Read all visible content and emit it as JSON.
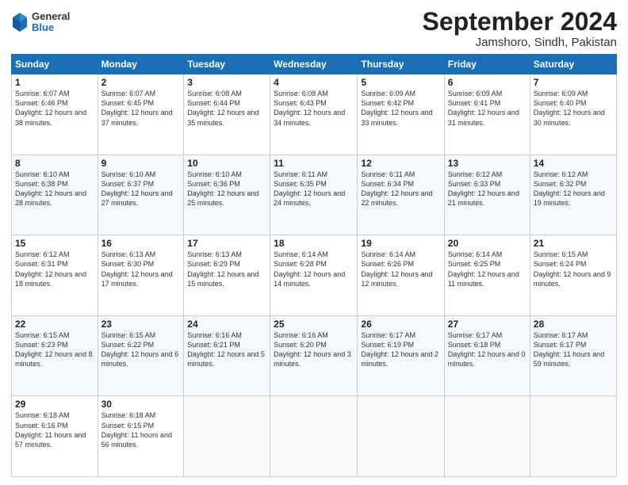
{
  "header": {
    "logo": {
      "line1": "General",
      "line2": "Blue"
    },
    "title": "September 2024",
    "location": "Jamshoro, Sindh, Pakistan"
  },
  "days_of_week": [
    "Sunday",
    "Monday",
    "Tuesday",
    "Wednesday",
    "Thursday",
    "Friday",
    "Saturday"
  ],
  "weeks": [
    [
      {
        "day": "1",
        "sunrise": "6:07 AM",
        "sunset": "6:46 PM",
        "daylight": "12 hours and 38 minutes."
      },
      {
        "day": "2",
        "sunrise": "6:07 AM",
        "sunset": "6:45 PM",
        "daylight": "12 hours and 37 minutes."
      },
      {
        "day": "3",
        "sunrise": "6:08 AM",
        "sunset": "6:44 PM",
        "daylight": "12 hours and 35 minutes."
      },
      {
        "day": "4",
        "sunrise": "6:08 AM",
        "sunset": "6:43 PM",
        "daylight": "12 hours and 34 minutes."
      },
      {
        "day": "5",
        "sunrise": "6:09 AM",
        "sunset": "6:42 PM",
        "daylight": "12 hours and 33 minutes."
      },
      {
        "day": "6",
        "sunrise": "6:09 AM",
        "sunset": "6:41 PM",
        "daylight": "12 hours and 31 minutes."
      },
      {
        "day": "7",
        "sunrise": "6:09 AM",
        "sunset": "6:40 PM",
        "daylight": "12 hours and 30 minutes."
      }
    ],
    [
      {
        "day": "8",
        "sunrise": "6:10 AM",
        "sunset": "6:38 PM",
        "daylight": "12 hours and 28 minutes."
      },
      {
        "day": "9",
        "sunrise": "6:10 AM",
        "sunset": "6:37 PM",
        "daylight": "12 hours and 27 minutes."
      },
      {
        "day": "10",
        "sunrise": "6:10 AM",
        "sunset": "6:36 PM",
        "daylight": "12 hours and 25 minutes."
      },
      {
        "day": "11",
        "sunrise": "6:11 AM",
        "sunset": "6:35 PM",
        "daylight": "12 hours and 24 minutes."
      },
      {
        "day": "12",
        "sunrise": "6:11 AM",
        "sunset": "6:34 PM",
        "daylight": "12 hours and 22 minutes."
      },
      {
        "day": "13",
        "sunrise": "6:12 AM",
        "sunset": "6:33 PM",
        "daylight": "12 hours and 21 minutes."
      },
      {
        "day": "14",
        "sunrise": "6:12 AM",
        "sunset": "6:32 PM",
        "daylight": "12 hours and 19 minutes."
      }
    ],
    [
      {
        "day": "15",
        "sunrise": "6:12 AM",
        "sunset": "6:31 PM",
        "daylight": "12 hours and 18 minutes."
      },
      {
        "day": "16",
        "sunrise": "6:13 AM",
        "sunset": "6:30 PM",
        "daylight": "12 hours and 17 minutes."
      },
      {
        "day": "17",
        "sunrise": "6:13 AM",
        "sunset": "6:29 PM",
        "daylight": "12 hours and 15 minutes."
      },
      {
        "day": "18",
        "sunrise": "6:14 AM",
        "sunset": "6:28 PM",
        "daylight": "12 hours and 14 minutes."
      },
      {
        "day": "19",
        "sunrise": "6:14 AM",
        "sunset": "6:26 PM",
        "daylight": "12 hours and 12 minutes."
      },
      {
        "day": "20",
        "sunrise": "6:14 AM",
        "sunset": "6:25 PM",
        "daylight": "12 hours and 11 minutes."
      },
      {
        "day": "21",
        "sunrise": "6:15 AM",
        "sunset": "6:24 PM",
        "daylight": "12 hours and 9 minutes."
      }
    ],
    [
      {
        "day": "22",
        "sunrise": "6:15 AM",
        "sunset": "6:23 PM",
        "daylight": "12 hours and 8 minutes."
      },
      {
        "day": "23",
        "sunrise": "6:15 AM",
        "sunset": "6:22 PM",
        "daylight": "12 hours and 6 minutes."
      },
      {
        "day": "24",
        "sunrise": "6:16 AM",
        "sunset": "6:21 PM",
        "daylight": "12 hours and 5 minutes."
      },
      {
        "day": "25",
        "sunrise": "6:16 AM",
        "sunset": "6:20 PM",
        "daylight": "12 hours and 3 minutes."
      },
      {
        "day": "26",
        "sunrise": "6:17 AM",
        "sunset": "6:19 PM",
        "daylight": "12 hours and 2 minutes."
      },
      {
        "day": "27",
        "sunrise": "6:17 AM",
        "sunset": "6:18 PM",
        "daylight": "12 hours and 0 minutes."
      },
      {
        "day": "28",
        "sunrise": "6:17 AM",
        "sunset": "6:17 PM",
        "daylight": "11 hours and 59 minutes."
      }
    ],
    [
      {
        "day": "29",
        "sunrise": "6:18 AM",
        "sunset": "6:16 PM",
        "daylight": "11 hours and 57 minutes."
      },
      {
        "day": "30",
        "sunrise": "6:18 AM",
        "sunset": "6:15 PM",
        "daylight": "11 hours and 56 minutes."
      },
      null,
      null,
      null,
      null,
      null
    ]
  ]
}
